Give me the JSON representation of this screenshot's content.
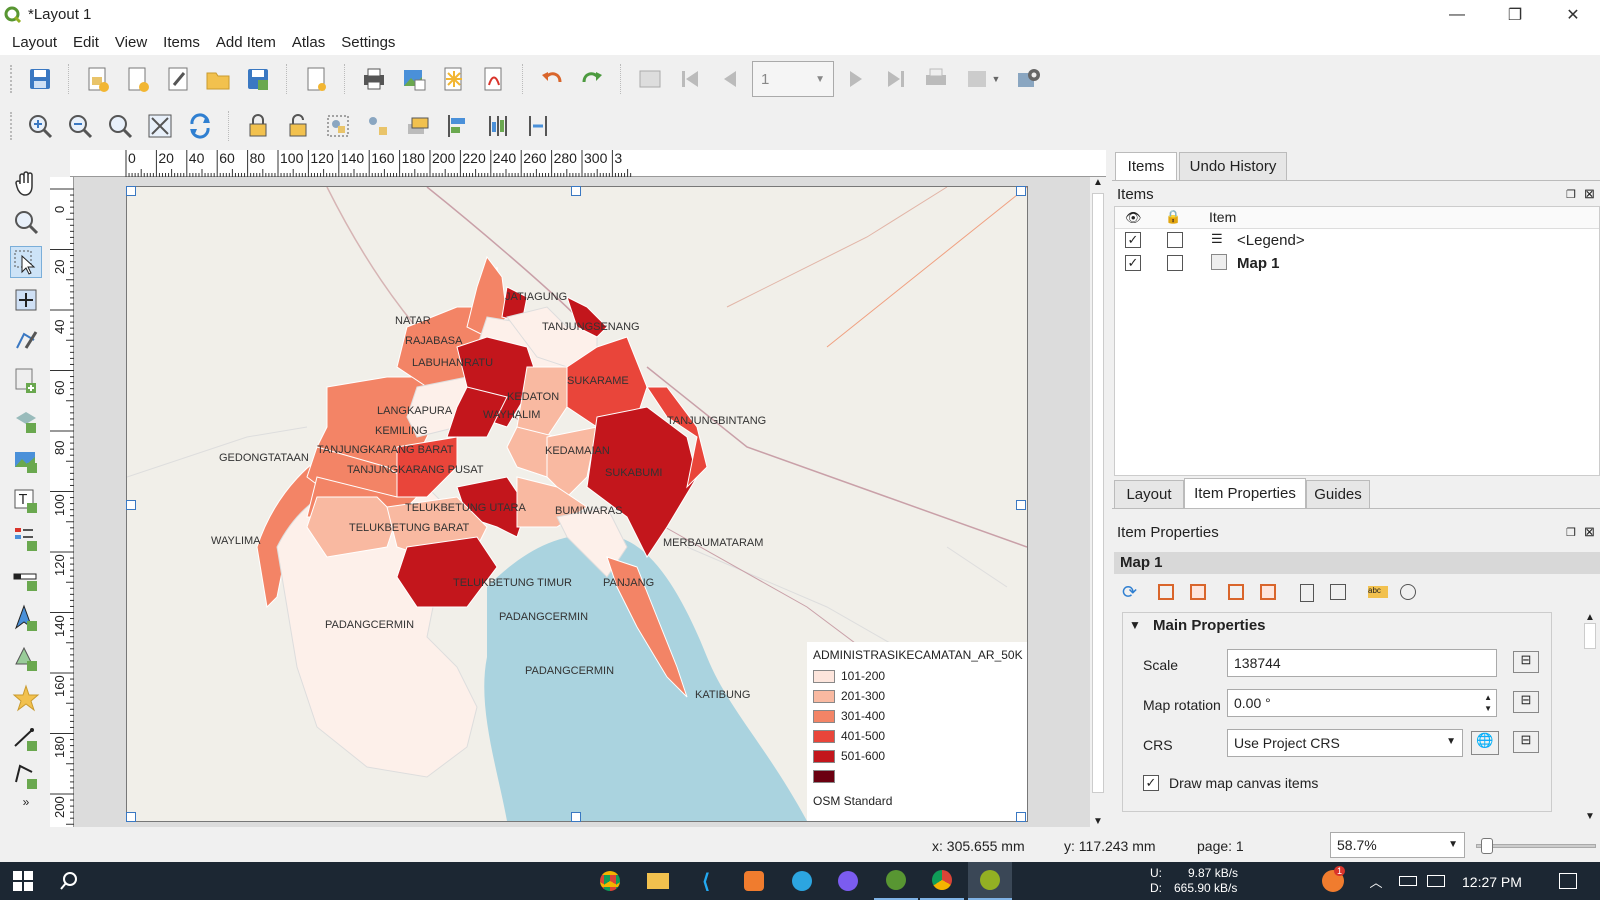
{
  "window": {
    "title": "*Layout 1"
  },
  "menu": [
    "Layout",
    "Edit",
    "View",
    "Items",
    "Add Item",
    "Atlas",
    "Settings"
  ],
  "atlas_toolbar": {
    "page_value": "1"
  },
  "ruler_h_ticks": [
    "0",
    "20",
    "40",
    "60",
    "80",
    "100",
    "120",
    "140",
    "160",
    "180",
    "200",
    "220",
    "240",
    "260",
    "280",
    "300",
    "3"
  ],
  "ruler_v_ticks": [
    "0",
    "20",
    "40",
    "60",
    "80",
    "100",
    "120",
    "140",
    "160",
    "180",
    "200"
  ],
  "map": {
    "labels": [
      "NATAR",
      "RAJABASA",
      "LABUHANRATU",
      "TANJUNGSENANG",
      "SUKARAME",
      "LANGKAPURA",
      "KEMILING",
      "WAYHALIM",
      "KEDATON",
      "TANJUNGKARANG BARAT",
      "TANJUNGKARANG PUSAT",
      "KEDAMAIAN",
      "SUKABUMI",
      "TANJUNGBINTANG",
      "GEDONGTATAAN",
      "TELUKBETUNG UTARA",
      "TELUKBETUNG BARAT",
      "BUMIWARAS",
      "WAYLIMA",
      "MERBAUMATARAM",
      "TELUKBETUNG TIMUR",
      "PANJANG",
      "PADANGCERMIN",
      "PADANGCERMIN",
      "PADANGCERMIN",
      "KATIBUNG",
      "JATIAGUNG"
    ]
  },
  "legend": {
    "title": "ADMINISTRASIKECAMATAN_AR_50K",
    "classes": [
      {
        "label": "101-200",
        "color": "#fde5dc"
      },
      {
        "label": "201-300",
        "color": "#f9b9a1"
      },
      {
        "label": "301-400",
        "color": "#f38466"
      },
      {
        "label": "401-500",
        "color": "#e9453a"
      },
      {
        "label": "501-600",
        "color": "#c3161c"
      },
      {
        "label": "",
        "color": "#6b0010"
      }
    ],
    "basemap": "OSM Standard"
  },
  "items_panel": {
    "tabs": [
      "Items",
      "Undo History"
    ],
    "title": "Items",
    "header_item": "Item",
    "rows": [
      {
        "name": "<Legend>",
        "visible": true,
        "locked": false,
        "bold": false
      },
      {
        "name": "Map 1",
        "visible": true,
        "locked": false,
        "bold": true
      }
    ]
  },
  "properties_panel": {
    "tabs": [
      "Layout",
      "Item Properties",
      "Guides"
    ],
    "title": "Item Properties",
    "item_name": "Map 1",
    "section": "Main Properties",
    "scale_label": "Scale",
    "scale_value": "138744",
    "rotation_label": "Map rotation",
    "rotation_value": "0.00 °",
    "crs_label": "CRS",
    "crs_value": "Use Project CRS",
    "draw_items_label": "Draw map canvas items",
    "draw_items_checked": true
  },
  "status": {
    "x": "x: 305.655 mm",
    "y": "y: 117.243 mm",
    "page": "page: 1",
    "zoom": "58.7%"
  },
  "taskbar": {
    "net_up": "U:",
    "net_up_val": "9.87 kB/s",
    "net_down": "D:",
    "net_down_val": "665.90 kB/s",
    "time": "12:27 PM",
    "badge": "1"
  }
}
